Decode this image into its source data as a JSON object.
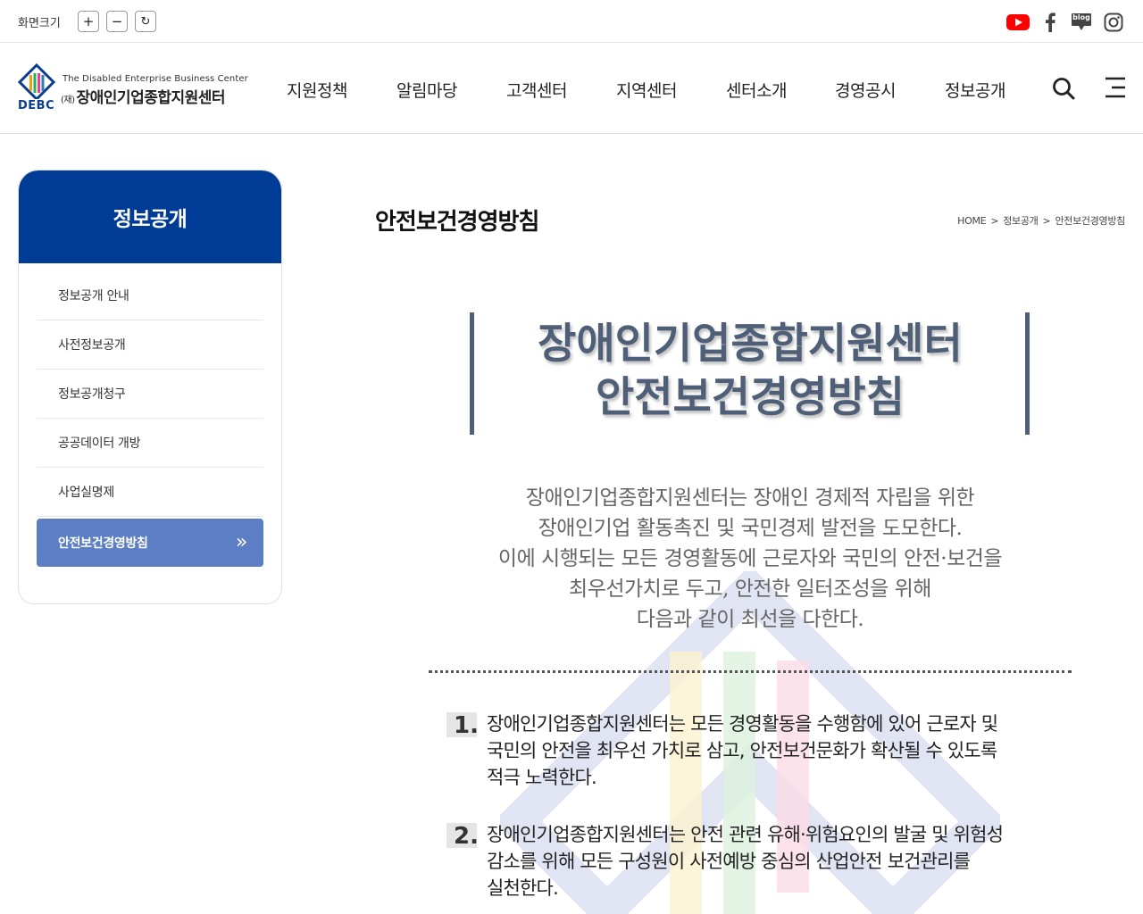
{
  "util_bar": {
    "zoom_label": "화면크기",
    "zoom_in": "+",
    "zoom_out": "−",
    "zoom_reset": "↻",
    "blog_label": "blog",
    "colors": {
      "youtube": "#ff0000",
      "icon": "#444444"
    }
  },
  "logo": {
    "english": "The Disabled Enterprise Business Center",
    "prefix": "(재)",
    "korean": "장애인기업종합지원센터",
    "abbr": "DEBC"
  },
  "gnb": [
    "지원정책",
    "알림마당",
    "고객센터",
    "지역센터",
    "센터소개",
    "경영공시",
    "정보공개"
  ],
  "sidebar": {
    "title": "정보공개",
    "items": [
      {
        "label": "정보공개 안내"
      },
      {
        "label": "사전정보공개"
      },
      {
        "label": "정보공개청구"
      },
      {
        "label": "공공데이터 개방"
      },
      {
        "label": "사업실명제"
      },
      {
        "label": "안전보건경영방침",
        "active": true
      }
    ],
    "active_icon": "»",
    "colors": {
      "header": "#003b95",
      "active": "#5b7ec4"
    }
  },
  "page": {
    "title": "안전보건경영방침",
    "breadcrumb": [
      "HOME",
      "정보공개",
      "안전보건경영방침"
    ],
    "breadcrumb_sep": ">"
  },
  "policy": {
    "heading_line1": "장애인기업종합지원센터",
    "heading_line2": "안전보건경영방침",
    "intro": [
      "장애인기업종합지원센터는 장애인 경제적 자립을 위한",
      "장애인기업 활동촉진 및 국민경제 발전을 도모한다.",
      "이에 시행되는 모든 경영활동에 근로자와 국민의 안전·보건을",
      "최우선가치로 두고, 안전한 일터조성을 위해",
      "다음과 같이 최선을 다한다."
    ],
    "items": [
      {
        "num": "1.",
        "lines": [
          "장애인기업종합지원센터는 모든 경영활동을 수행함에 있어 근로자 및",
          "국민의 안전을 최우선 가치로 삼고, 안전보건문화가 확산될 수 있도록",
          "적극 노력한다."
        ]
      },
      {
        "num": "2.",
        "lines": [
          "장애인기업종합지원센터는 안전 관련 유해·위험요인의 발굴 및 위험성",
          "감소를 위해 모든 구성원이 사전예방 중심의 산업안전 보건관리를",
          "실천한다."
        ]
      }
    ],
    "colors": {
      "heading": "#4e5f77"
    }
  }
}
